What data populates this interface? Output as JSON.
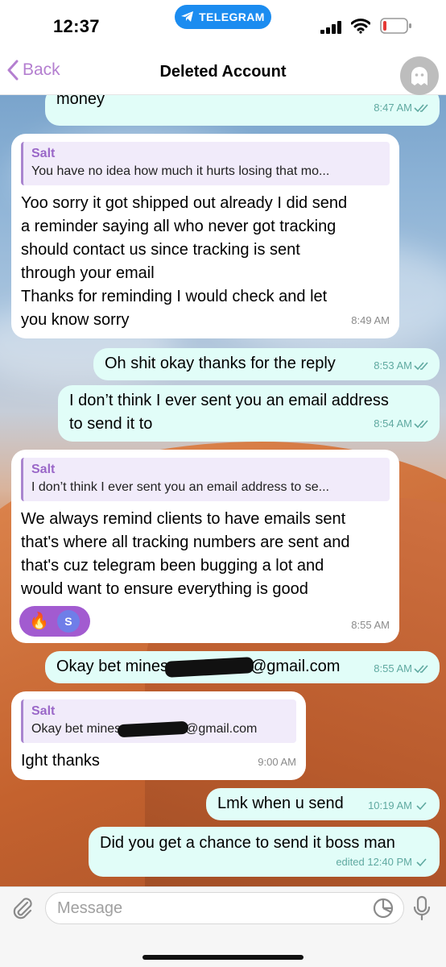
{
  "status_bar": {
    "time": "12:37",
    "pill_label": "TELEGRAM"
  },
  "nav": {
    "back_label": "Back",
    "title": "Deleted Account"
  },
  "messages": [
    {
      "text": "money",
      "time": "8:47 AM"
    },
    {
      "reply_name": "Salt",
      "reply_text": "You have no idea how much it hurts losing that mo...",
      "text": "Yoo sorry it got shipped out already I did send\na reminder saying all who never got tracking\nshould contact us since tracking is sent\nthrough your email\nThanks for reminding I would check and let\nyou know sorry",
      "time": "8:49 AM"
    },
    {
      "text": "Oh shit okay thanks for the reply",
      "time": "8:53 AM"
    },
    {
      "text": "I don’t think I ever sent you an email address\nto send it to",
      "time": "8:54 AM"
    },
    {
      "reply_name": "Salt",
      "reply_text": "I don’t think I ever sent you an email address to se...",
      "text": "We always remind clients to have emails sent\nthat's where all tracking numbers are sent and\nthat's cuz telegram been bugging a lot and\nwould want to ensure everything is good",
      "reaction_emoji": "🔥",
      "reaction_avatar": "S",
      "time": "8:55 AM"
    },
    {
      "text_before": "Okay bet mines",
      "text_after": "@gmail.com",
      "time": "8:55 AM"
    },
    {
      "reply_name": "Salt",
      "reply_before": "Okay bet mines",
      "reply_after": "@gmail.com",
      "text": "Ight thanks",
      "time": "9:00 AM"
    },
    {
      "text": "Lmk when u send",
      "time": "10:19 AM"
    },
    {
      "text": "Did you get a chance to send it boss man",
      "time": "edited 12:40 PM"
    }
  ],
  "input": {
    "placeholder": "Message"
  },
  "colors": {
    "accent": "#b47fd0",
    "incoming_bubble": "#ffffff",
    "outgoing_bubble": "#e1fdf8",
    "telegram_pill": "#1b8cf0",
    "reaction": "#a25bd0"
  },
  "icons": [
    "signal-icon",
    "wifi-icon",
    "battery-icon",
    "back-chevron-icon",
    "ghost-icon",
    "double-check-icon",
    "single-check-icon",
    "attach-icon",
    "sticker-icon",
    "mic-icon"
  ]
}
